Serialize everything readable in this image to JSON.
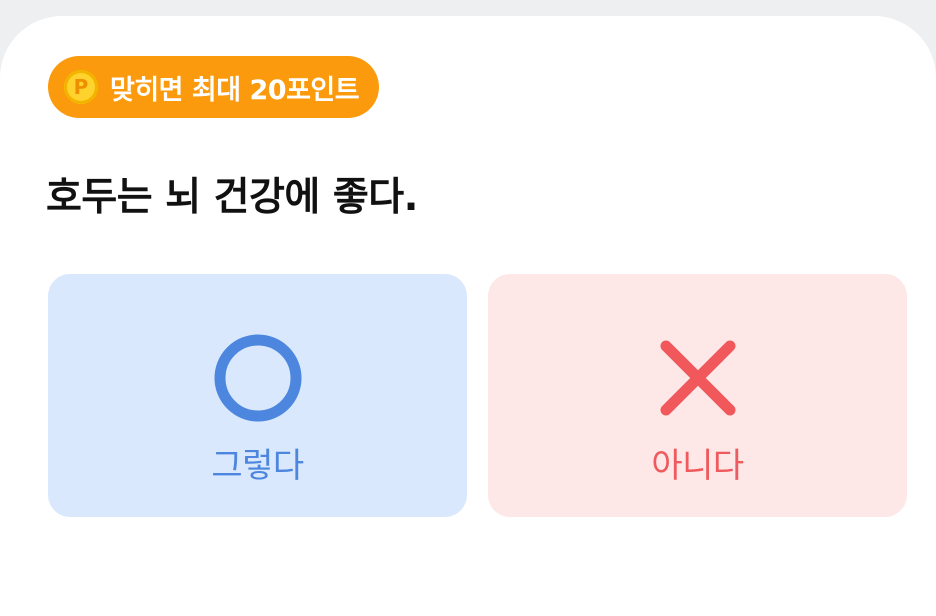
{
  "badge": {
    "coin_letter": "P",
    "text": "맞히면 최대 20포인트",
    "color": "#fb9a0c"
  },
  "question": {
    "text": "호두는 뇌 건강에 좋다."
  },
  "answers": [
    {
      "label": "그렇다",
      "icon": "circle-o-icon",
      "color": "#4c86de",
      "background": "#d9e8fd"
    },
    {
      "label": "아니다",
      "icon": "x-mark-icon",
      "color": "#f0585c",
      "background": "#fde7e7"
    }
  ]
}
